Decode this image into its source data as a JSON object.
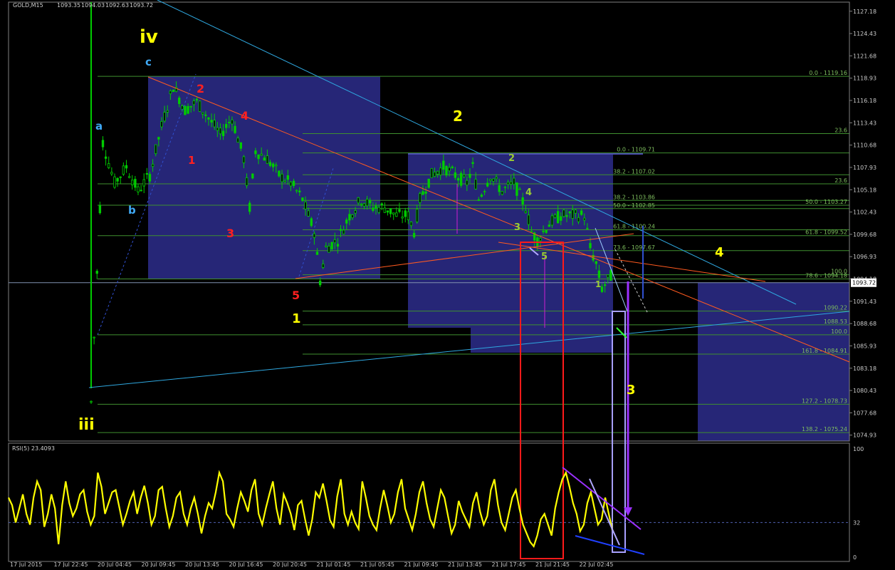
{
  "chart_data": {
    "type": "candlestick",
    "symbol_header": "GOLD,M15",
    "ohlc": [
      "1093.35",
      "1094.03",
      "1092.63",
      "1093.72"
    ],
    "price_axis": {
      "ticks": [
        "1127.18",
        "1124.43",
        "1121.68",
        "1118.93",
        "1116.18",
        "1113.43",
        "1110.68",
        "1107.93",
        "1105.18",
        "1102.43",
        "1099.68",
        "1096.93",
        "1094.18",
        "1091.43",
        "1088.68",
        "1085.93",
        "1083.18",
        "1080.43",
        "1077.68",
        "1074.93"
      ],
      "range": [
        1074.2,
        1128.3
      ],
      "current_price": "1093.72"
    },
    "time_axis": {
      "labels": [
        "17 Jul 2015",
        "17 Jul 22:45",
        "20 Jul 04:45",
        "20 Jul 09:45",
        "20 Jul 13:45",
        "20 Jul 16:45",
        "20 Jul 20:45",
        "21 Jul 01:45",
        "21 Jul 05:45",
        "21 Jul 09:45",
        "21 Jul 13:45",
        "21 Jul 17:45",
        "21 Jul 21:45",
        "22 Jul 02:45"
      ]
    },
    "price_series_approx": [
      [
        0,
        1079
      ],
      [
        4,
        1111
      ],
      [
        8,
        1106
      ],
      [
        12,
        1108
      ],
      [
        16,
        1105
      ],
      [
        20,
        1107
      ],
      [
        24,
        1113
      ],
      [
        28,
        1118
      ],
      [
        32,
        1115
      ],
      [
        36,
        1116
      ],
      [
        40,
        1114
      ],
      [
        44,
        1112
      ],
      [
        48,
        1114
      ],
      [
        52,
        1109
      ],
      [
        54,
        1103
      ],
      [
        56,
        1110
      ],
      [
        60,
        1109
      ],
      [
        64,
        1107
      ],
      [
        68,
        1106
      ],
      [
        72,
        1104
      ],
      [
        76,
        1100
      ],
      [
        78,
        1094
      ],
      [
        80,
        1098
      ],
      [
        84,
        1099
      ],
      [
        88,
        1102
      ],
      [
        92,
        1104
      ],
      [
        96,
        1103
      ],
      [
        100,
        1103
      ],
      [
        104,
        1102
      ],
      [
        108,
        1102
      ],
      [
        110,
        1100
      ],
      [
        112,
        1104
      ],
      [
        116,
        1107
      ],
      [
        120,
        1108
      ],
      [
        124,
        1107
      ],
      [
        128,
        1106
      ],
      [
        130,
        1108
      ],
      [
        132,
        1104
      ],
      [
        136,
        1107
      ],
      [
        140,
        1105
      ],
      [
        144,
        1106
      ],
      [
        148,
        1103
      ],
      [
        150,
        1100
      ],
      [
        152,
        1099
      ],
      [
        156,
        1101
      ],
      [
        160,
        1102
      ],
      [
        164,
        1102
      ],
      [
        168,
        1102
      ],
      [
        170,
        1098
      ],
      [
        172,
        1096
      ],
      [
        174,
        1093
      ],
      [
        176,
        1094
      ],
      [
        178,
        1095
      ]
    ],
    "fibonacci_levels": [
      {
        "label": "0.0 - 1119.16",
        "price": 1119.16
      },
      {
        "label": "23.6",
        "price": 1112.1
      },
      {
        "label": "0.0 - 1109.71",
        "price": 1109.71
      },
      {
        "label": "38.2 - 1107.02",
        "price": 1107.02
      },
      {
        "label": "23.6",
        "price": 1105.9
      },
      {
        "label": "38.2 - 1103.86",
        "price": 1103.86
      },
      {
        "label": "50.0 - 1103.27",
        "price": 1103.27
      },
      {
        "label": "50.0 - 1102.85",
        "price": 1102.85
      },
      {
        "label": "61.8 - 1100.24",
        "price": 1100.24
      },
      {
        "label": "61.8 - 1099.52",
        "price": 1099.52
      },
      {
        "label": "73.6 - 1097.67",
        "price": 1097.67
      },
      {
        "label": "100.0",
        "price": 1094.7
      },
      {
        "label": "78.6 - 1094.18",
        "price": 1094.18
      },
      {
        "label": "1090.22",
        "price": 1090.22
      },
      {
        "label": "1088.53",
        "price": 1088.53
      },
      {
        "label": "100.0",
        "price": 1087.3
      },
      {
        "label": "161.8 - 1084.91",
        "price": 1084.91
      },
      {
        "label": "127.2 - 1078.73",
        "price": 1078.73
      },
      {
        "label": "138.2 - 1075.24",
        "price": 1075.24
      }
    ],
    "wave_labels": [
      {
        "text": "iv",
        "color": "#ffff00"
      },
      {
        "text": "iii",
        "color": "#ffff00"
      },
      {
        "text": "2",
        "color": "#ffff00"
      },
      {
        "text": "1",
        "color": "#ffff00"
      },
      {
        "text": "4",
        "color": "#ffff00"
      },
      {
        "text": "3",
        "color": "#ffff00"
      },
      {
        "text": "a",
        "color": "#3fa9f5"
      },
      {
        "text": "b",
        "color": "#3fa9f5"
      },
      {
        "text": "c",
        "color": "#3fa9f5"
      },
      {
        "text": "1",
        "color": "#ff2020"
      },
      {
        "text": "2",
        "color": "#ff2020"
      },
      {
        "text": "3",
        "color": "#ff2020"
      },
      {
        "text": "4",
        "color": "#ff2020"
      },
      {
        "text": "5",
        "color": "#ff2020"
      },
      {
        "text": "1",
        "color": "#9acd32"
      },
      {
        "text": "2",
        "color": "#9acd32"
      },
      {
        "text": "3",
        "color": "#9acd32"
      },
      {
        "text": "4",
        "color": "#9acd32"
      },
      {
        "text": "5",
        "color": "#9acd32"
      }
    ],
    "rsi": {
      "header": "RSI(5) 23.4093",
      "ticks": [
        "100",
        "32",
        "0"
      ],
      "range": [
        0,
        100
      ],
      "level": 32,
      "values": [
        55,
        48,
        32,
        45,
        58,
        40,
        30,
        55,
        70,
        62,
        28,
        40,
        58,
        45,
        12,
        48,
        70,
        50,
        38,
        45,
        58,
        62,
        42,
        30,
        38,
        78,
        65,
        40,
        50,
        60,
        62,
        46,
        30,
        40,
        52,
        60,
        40,
        55,
        66,
        50,
        30,
        38,
        62,
        65,
        45,
        28,
        38,
        55,
        60,
        40,
        30,
        45,
        55,
        40,
        22,
        38,
        50,
        45,
        60,
        78,
        70,
        40,
        35,
        28,
        45,
        60,
        52,
        42,
        62,
        72,
        40,
        30,
        45,
        58,
        70,
        45,
        30,
        58,
        50,
        40,
        25,
        48,
        52,
        35,
        20,
        35,
        60,
        55,
        68,
        52,
        34,
        28,
        56,
        72,
        40,
        30,
        42,
        32,
        26,
        70,
        55,
        38,
        30,
        25,
        45,
        62,
        48,
        32,
        40,
        60,
        72,
        45,
        35,
        25,
        40,
        60,
        70,
        50,
        35,
        28,
        45,
        62,
        55,
        38,
        22,
        30,
        52,
        42,
        35,
        28,
        50,
        60,
        42,
        30,
        38,
        62,
        72,
        48,
        32,
        25,
        40,
        55,
        62,
        45,
        30,
        22,
        14,
        10,
        20,
        35,
        40,
        30,
        20,
        45,
        60,
        72,
        78,
        65,
        50,
        40,
        24,
        30,
        50,
        60,
        45,
        30,
        35,
        55,
        40,
        25
      ]
    },
    "colors": {
      "background": "#000000",
      "candles": "#00cc00",
      "fib": "#3f8f2f",
      "rsi_line": "#ffff00",
      "zone": "#2d2d8c",
      "trend_cyan": "#2fa8e0",
      "trend_orange": "#ff5a1f",
      "box_red": "#ff1a1a",
      "box_lavender": "#a8a0ff"
    }
  }
}
